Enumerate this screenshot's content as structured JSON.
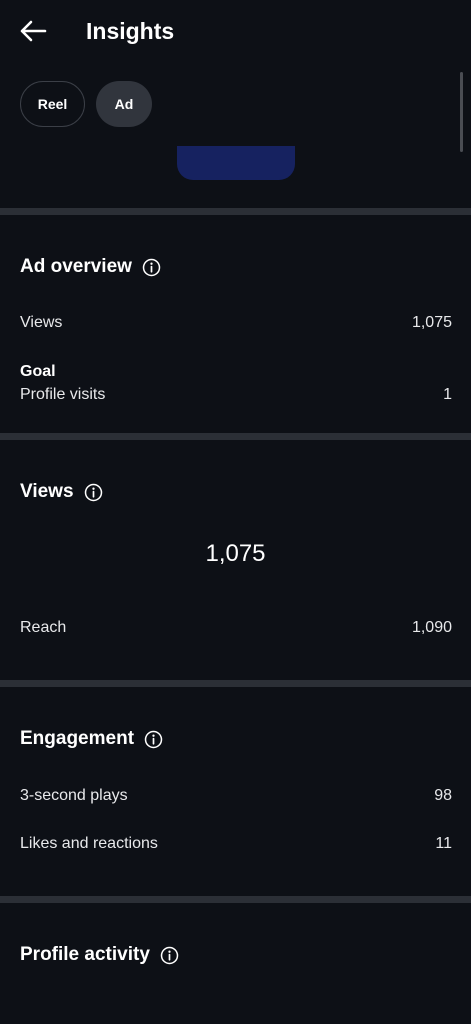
{
  "header": {
    "title": "Insights"
  },
  "chips": {
    "reel": "Reel",
    "ad": "Ad"
  },
  "ad_overview": {
    "title": "Ad overview",
    "views_label": "Views",
    "views_value": "1,075",
    "goal_label": "Goal",
    "goal_metric_label": "Profile visits",
    "goal_metric_value": "1"
  },
  "views": {
    "title": "Views",
    "total": "1,075",
    "reach_label": "Reach",
    "reach_value": "1,090"
  },
  "engagement": {
    "title": "Engagement",
    "plays_label": "3-second plays",
    "plays_value": "98",
    "likes_label": "Likes and reactions",
    "likes_value": "11"
  },
  "profile_activity": {
    "title": "Profile activity"
  },
  "icons": {
    "back": "arrow-left-icon",
    "info": "info-circle-icon"
  },
  "colors": {
    "background": "#0d1016",
    "divider": "#2b2f36",
    "chip_selected": "#31353d",
    "preview": "#162260"
  }
}
